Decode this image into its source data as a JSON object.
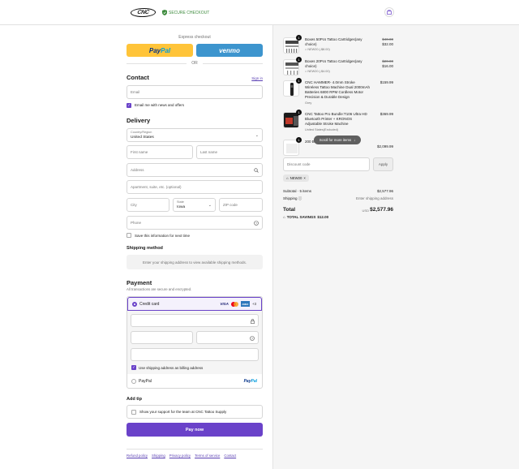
{
  "header": {
    "logo_text": "CNC",
    "secure_label": "SECURE CHECKOUT",
    "icons": {
      "shield": "shield-icon",
      "cart": "bag-icon"
    }
  },
  "express": {
    "title": "Express checkout",
    "paypal_part1": "Pay",
    "paypal_part2": "Pal",
    "venmo_label": "venmo",
    "or_label": "OR"
  },
  "contact": {
    "title": "Contact",
    "signin_label": "Sign in",
    "email_placeholder": "Email",
    "email_news_label": "Email me with news and offers",
    "email_news_checked": true
  },
  "delivery": {
    "title": "Delivery",
    "country_label": "Country/Region",
    "country_value": "United States",
    "first_name_placeholder": "First name",
    "last_name_placeholder": "Last name",
    "address_placeholder": "Address",
    "apartment_placeholder": "Apartment, suite, etc. (optional)",
    "city_placeholder": "City",
    "state_label": "State",
    "state_value": "Iowa",
    "zip_placeholder": "ZIP code",
    "phone_placeholder": "Phone",
    "save_info_label": "Save this information for next time",
    "save_info_checked": false
  },
  "shipping_method": {
    "title": "Shipping method",
    "note": "Enter your shipping address to view available shipping methods."
  },
  "payment": {
    "title": "Payment",
    "subtitle": "All transactions are secure and encrypted.",
    "credit_card_label": "Credit card",
    "card_brands": [
      "VISA",
      "Mastercard",
      "AMEX"
    ],
    "amex_text": "AMEX",
    "visa_text": "VISA",
    "more_cards": "+3",
    "billing_same_label": "Use shipping address as billing address",
    "billing_same_checked": true,
    "paypal_label": "PayPal",
    "paypal_logo_1": "Pay",
    "paypal_logo_2": "Pal"
  },
  "tip": {
    "title": "Add tip",
    "support_label": "Show your support for the team at CNC Tattoo Supply",
    "checked": false
  },
  "pay_now_label": "Pay now",
  "footer_links": [
    "Refund policy",
    "Shipping",
    "Privacy policy",
    "Terms of service",
    "Contact"
  ],
  "cart": {
    "items": [
      {
        "qty": "1",
        "name": "Boxes 50Pcs Tattoo Cartridges(any choice)",
        "discount": "NEW20 (-$8.00)",
        "old_price": "$40.00",
        "price": "$32.00"
      },
      {
        "qty": "1",
        "name": "Boxes 20Pcs Tattoo Cartridges(any choice)",
        "discount": "NEW20 (-$4.00)",
        "old_price": "$20.00",
        "price": "$16.00"
      },
      {
        "qty": "1",
        "name": "CNC HAMMER- 4.0mm Stroke Wireless Tattoo Machine Dual 2000mAh Batteries 6800 RPM Cordless Motor Precision & Durable Design",
        "variant": "Grey",
        "price": "$159.99"
      },
      {
        "qty": "1",
        "name": "CNC Tattoo Pro Bundle:T106 Ultra HD Bluetooth Printer + KRONOS Adjustable Stroke Machine",
        "variant": "United States(Excluded)",
        "price": "$369.99"
      },
      {
        "qty": "1",
        "name": "200 Boxes Tattoo Cartridges",
        "price": "$2,099.99"
      }
    ],
    "scroll_hint": "Scroll for more items",
    "discount_placeholder": "Discount code",
    "apply_label": "Apply",
    "applied_code": "NEW20",
    "subtotal_label": "Subtotal · 5 items",
    "subtotal_value": "$2,577.96",
    "shipping_label": "Shipping",
    "shipping_value": "Enter shipping address",
    "total_label": "Total",
    "currency": "USD",
    "total_value": "$2,577.96",
    "savings_label": "TOTAL SAVINGS",
    "savings_value": "$12.00"
  }
}
